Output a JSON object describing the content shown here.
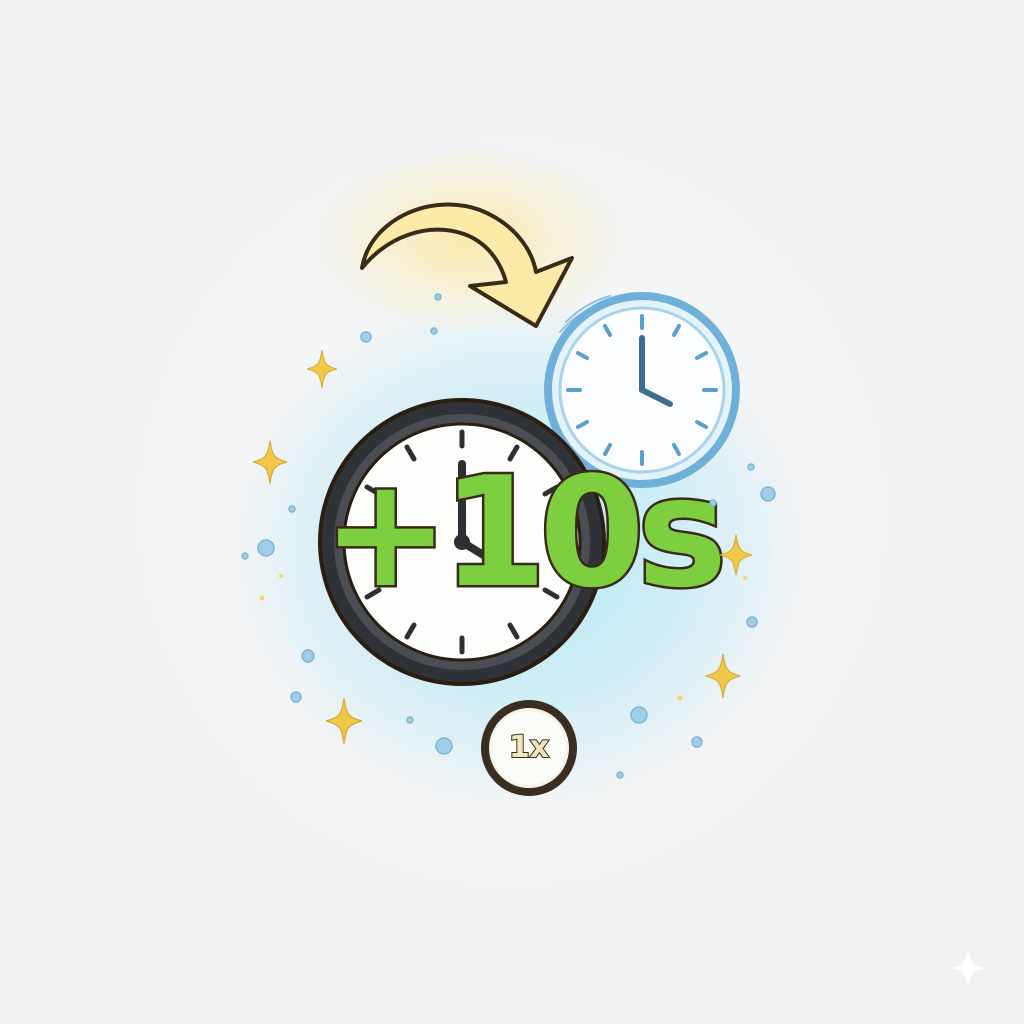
{
  "powerup": {
    "time_bonus_label": "+10s",
    "speed_label": "1x"
  },
  "icons": {
    "arrow": "curved-arrow-icon",
    "main_clock": "stopwatch-clock-icon",
    "ghost_clock": "clock-icon",
    "sparkle": "sparkle-icon",
    "bubble": "bubble-dot-icon"
  },
  "colors": {
    "bonus_green": "#7dcf3f",
    "outline_brown": "#3a2a18",
    "glow_cyan": "#7fdcf0",
    "ghost_clock_blue": "#7ab8dc",
    "arrow_yellow": "#fbeaa0",
    "sparkle_gold": "#f0c94a"
  }
}
